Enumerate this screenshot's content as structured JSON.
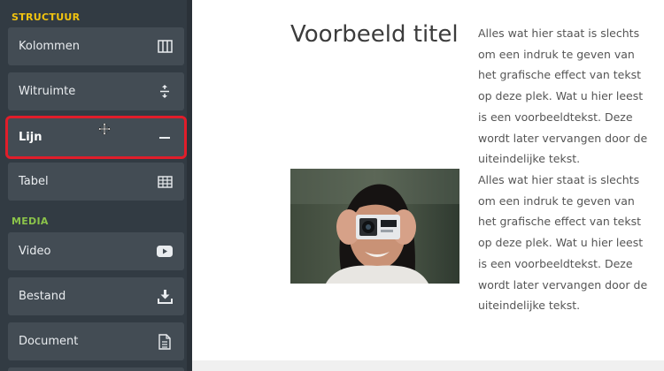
{
  "sidebar": {
    "sections": [
      {
        "label": "STRUCTUUR",
        "color": "#f2c40f",
        "items": [
          {
            "label": "Kolommen",
            "icon": "columns-icon"
          },
          {
            "label": "Witruimte",
            "icon": "vertical-spacing-icon"
          },
          {
            "label": "Lijn",
            "icon": "horizontal-line-icon",
            "selected": true
          },
          {
            "label": "Tabel",
            "icon": "table-icon"
          }
        ]
      },
      {
        "label": "MEDIA",
        "color": "#8bc34a",
        "items": [
          {
            "label": "Video",
            "icon": "youtube-icon"
          },
          {
            "label": "Bestand",
            "icon": "download-icon"
          },
          {
            "label": "Document",
            "icon": "document-icon"
          }
        ]
      }
    ]
  },
  "main": {
    "title": "Voorbeeld titel",
    "paragraph_1": "Alles wat hier staat is slechts om een indruk te geven van het grafische effect van tekst op deze plek. Wat u hier leest is een voorbeeldtekst. Deze wordt later vervangen door de uiteindelijke tekst.",
    "paragraph_2": "Alles wat hier staat is slechts om een indruk te geven van het grafische effect van tekst op deze plek. Wat u hier leest is een voorbeeldtekst. Deze wordt later vervangen door de uiteindelijke tekst.",
    "image": "woman-holding-action-camera"
  },
  "colors": {
    "sidebar_bg": "#323b43",
    "item_bg": "#434c54",
    "selection_outline": "#e11d2a",
    "structure_label": "#f2c40f",
    "media_label": "#8bc34a"
  }
}
